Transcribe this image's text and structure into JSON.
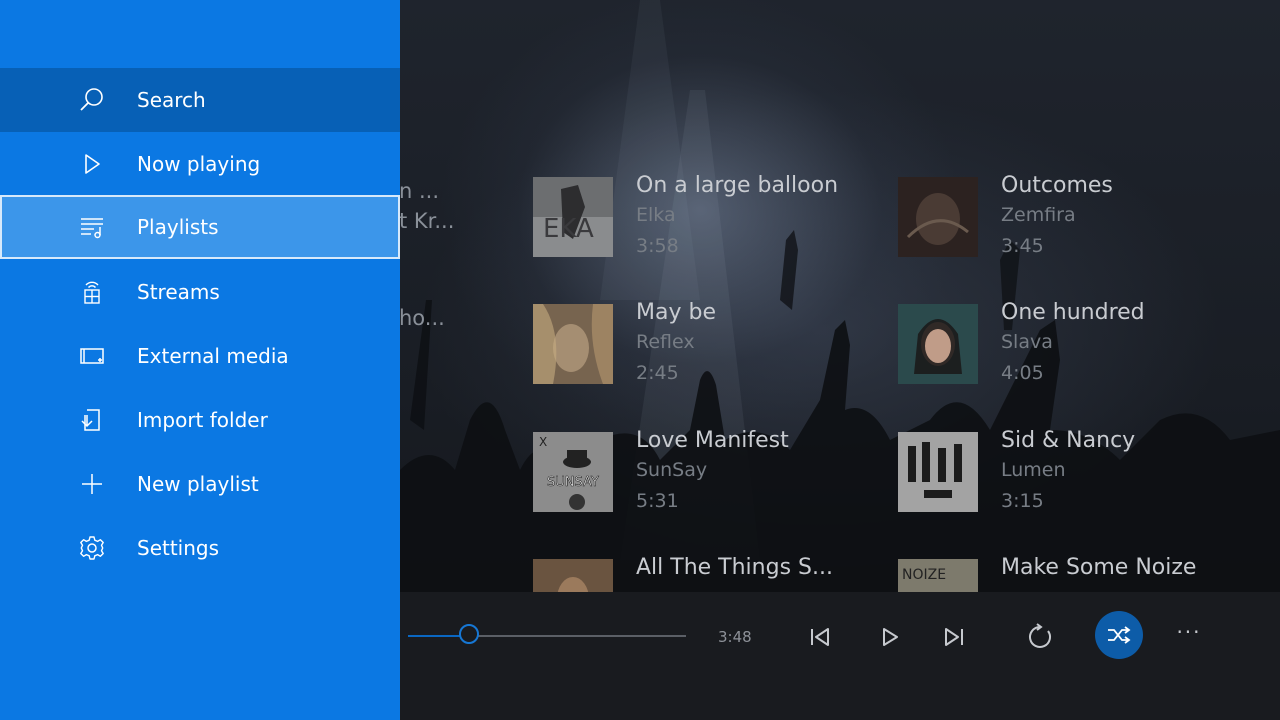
{
  "menu": {
    "items": [
      {
        "label": "Search",
        "icon": "search-icon",
        "state": "selected"
      },
      {
        "label": "Now playing",
        "icon": "play-icon",
        "state": "normal"
      },
      {
        "label": "Playlists",
        "icon": "playlist-icon",
        "state": "focused"
      },
      {
        "label": "Streams",
        "icon": "streams-icon",
        "state": "normal"
      },
      {
        "label": "External media",
        "icon": "external-media-icon",
        "state": "normal"
      },
      {
        "label": "Import folder",
        "icon": "import-folder-icon",
        "state": "normal"
      },
      {
        "label": "New playlist",
        "icon": "plus-icon",
        "state": "normal"
      },
      {
        "label": "Settings",
        "icon": "gear-icon",
        "state": "normal"
      }
    ]
  },
  "hidden_column": {
    "lines": [
      "n ...",
      "t Kr...",
      "ho..."
    ]
  },
  "songs": [
    {
      "title": "On a large balloon",
      "artist": "Elka",
      "duration": "3:58"
    },
    {
      "title": "Outcomes",
      "artist": "Zemfira",
      "duration": "3:45"
    },
    {
      "title": "May be",
      "artist": "Reflex",
      "duration": "2:45"
    },
    {
      "title": "One hundred",
      "artist": "Slava",
      "duration": "4:05"
    },
    {
      "title": "Love Manifest",
      "artist": "SunSay",
      "duration": "5:31"
    },
    {
      "title": "Sid & Nancy",
      "artist": "Lumen",
      "duration": "3:15"
    },
    {
      "title": "All The Things S...",
      "artist": "",
      "duration": ""
    },
    {
      "title": "Make Some Noize",
      "artist": "",
      "duration": ""
    }
  ],
  "player": {
    "time": "3:48",
    "progress": 0.22,
    "more_label": "···"
  },
  "colors": {
    "menu_bg": "#0b78e3",
    "menu_selected": "#0760b6",
    "menu_focused": "#3c96ea",
    "accent": "#1677d4"
  }
}
